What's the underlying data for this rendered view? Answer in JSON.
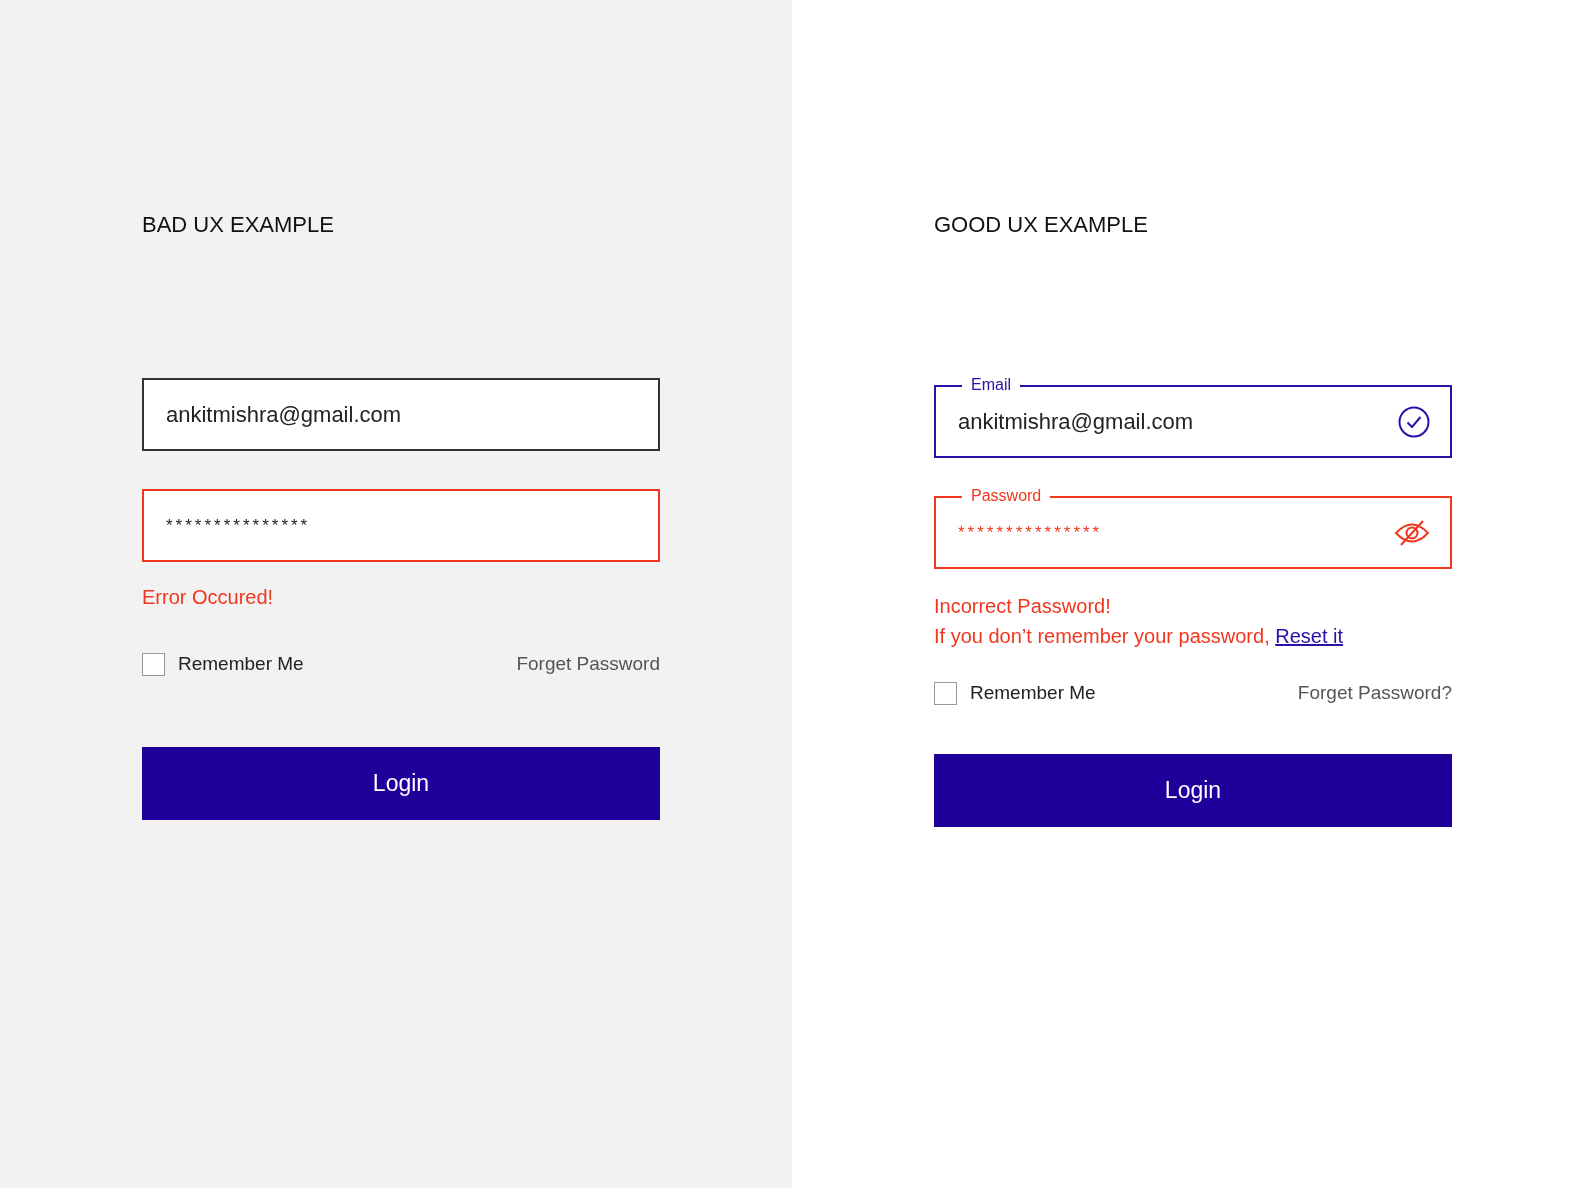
{
  "panels": [
    {
      "kind": "bad",
      "title": "BAD UX EXAMPLE",
      "status_icons": false,
      "fields": [
        {
          "kind": "email",
          "value": "ankitmishra@gmail.com",
          "valid": false,
          "error": false
        },
        {
          "kind": "password",
          "value": "***************",
          "valid": false,
          "error": true
        }
      ],
      "messages": [
        {
          "text": "Error Occured!"
        }
      ],
      "remember": {
        "label": "Remember Me",
        "checked": false
      },
      "forgot": "Forget Password",
      "button": "Login"
    },
    {
      "kind": "good",
      "title": "GOOD UX EXAMPLE",
      "status_icons": true,
      "fields": [
        {
          "kind": "email",
          "label": "Email",
          "value": "ankitmishra@gmail.com",
          "valid": true,
          "error": false
        },
        {
          "kind": "password",
          "label": "Password",
          "value": "***************",
          "valid": false,
          "error": true
        }
      ],
      "messages": [
        {
          "text": "Incorrect Password!"
        },
        {
          "text": "If you don’t remember your password, ",
          "link": "Reset it"
        }
      ],
      "remember": {
        "label": "Remember Me",
        "checked": false
      },
      "forgot": "Forget Password?",
      "button": "Login"
    }
  ]
}
